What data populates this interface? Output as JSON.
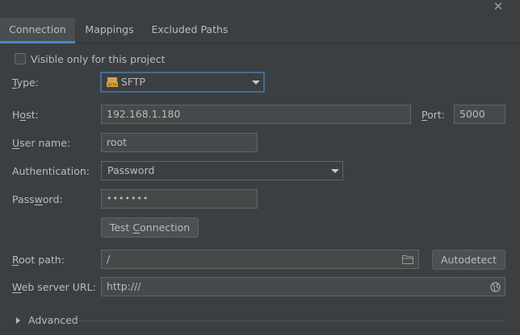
{
  "window": {
    "close_glyph": "✕"
  },
  "tabs": [
    {
      "label": "Connection",
      "active": true
    },
    {
      "label": "Mappings",
      "active": false
    },
    {
      "label": "Excluded Paths",
      "active": false
    }
  ],
  "visible_only": {
    "label": "Visible only for this project",
    "checked": false
  },
  "type": {
    "label": "Type:",
    "value": "SFTP",
    "icon": "sftp-icon"
  },
  "host": {
    "label": "Host:",
    "value": "192.168.1.180"
  },
  "port": {
    "label": "Port:",
    "value": "5000"
  },
  "user": {
    "label": "User name:",
    "value": "root"
  },
  "auth": {
    "label": "Authentication:",
    "value": "Password"
  },
  "password": {
    "label": "Password:",
    "value": "•••••••"
  },
  "test_connection": {
    "label": "Test Connection"
  },
  "root_path": {
    "label": "Root path:",
    "value": "/"
  },
  "autodetect": {
    "label": "Autodetect"
  },
  "web_server": {
    "label": "Web server URL:",
    "value": "http:///"
  },
  "advanced": {
    "label": "Advanced"
  },
  "colors": {
    "accent": "#4a88c7",
    "focus": "#466d94",
    "background": "#3c3f41"
  }
}
